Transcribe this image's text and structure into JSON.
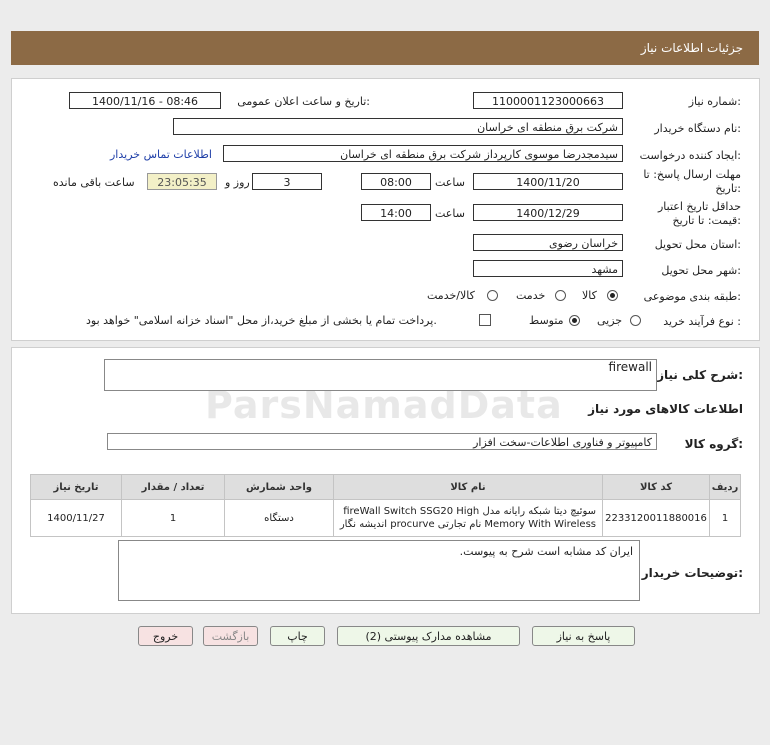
{
  "header": {
    "title": "جزئیات اطلاعات نیاز"
  },
  "form": {
    "need_number_label": "شماره نیاز:",
    "need_number": "1100001123000663",
    "announce_label": "تاریخ و ساعت اعلان عمومی:",
    "announce_value": "1400/11/16 - 08:46",
    "buyer_label": "نام دستگاه خریدار:",
    "buyer_value": "شرکت برق منطقه ای خراسان",
    "creator_label": "ایجاد کننده درخواست:",
    "creator_value": "سیدمجدرضا موسوی کارپرداز شرکت برق منطقه ای خراسان",
    "contact_link": "اطلاعات تماس خریدار",
    "deadline_label_1": "مهلت ارسال پاسخ: تا",
    "deadline_label_2": "تاریخ:",
    "deadline_date": "1400/11/20",
    "time_label": "ساعت",
    "deadline_time": "08:00",
    "days_value": "3",
    "days_label": "روز و",
    "remaining_value": "23:05:35",
    "remaining_label": "ساعت باقی مانده",
    "validity_label_1": "حداقل تاریخ اعتبار",
    "validity_label_2": "قیمت: تا تاریخ:",
    "validity_date": "1400/12/29",
    "validity_time_label": "ساعت",
    "validity_time": "14:00",
    "province_label": "استان محل تحویل:",
    "province_value": "خراسان رضوی",
    "city_label": "شهر محل تحویل:",
    "city_value": "مشهد",
    "category_label": "طبقه بندی موضوعی:",
    "category_options": [
      "کالا",
      "خدمت",
      "کالا/خدمت"
    ],
    "process_label": "نوع فرآیند خرید :",
    "process_options": [
      "جزیی",
      "متوسط"
    ],
    "payment_note": "پرداخت تمام یا بخشی از مبلغ خرید،از محل \"اسناد خزانه اسلامی\" خواهد بود."
  },
  "details": {
    "summary_label": "شرح کلی نیاز:",
    "summary_value": "firewall",
    "goods_info_title": "اطلاعات کالاهای مورد نیاز",
    "group_label": "گروه کالا:",
    "group_value": "کامپیوتر و فناوری اطلاعات-سخت افزار",
    "table": {
      "headers": [
        "ردیف",
        "کد کالا",
        "نام کالا",
        "واحد شمارش",
        "تعداد / مقدار",
        "تاریخ نیاز"
      ],
      "rows": [
        {
          "index": "1",
          "code": "2233120011880016",
          "name_line1": "سوئیچ دیتا شبکه رایانه مدل fireWall Switch SSG20 High",
          "name_line2": "Memory With Wireless نام تجارتی procurve اندیشه نگار",
          "unit": "دستگاه",
          "qty": "1",
          "date": "1400/11/27"
        }
      ]
    },
    "buyer_notes_label": "توضیحات خریدار:",
    "buyer_notes_value": "ایران کد مشابه است شرح به پیوست."
  },
  "buttons": {
    "reply": "پاسخ به نیاز",
    "docs": "مشاهده مدارک پیوستی (2)",
    "print": "چاپ",
    "back": "بازگشت",
    "exit": "خروج"
  },
  "watermark": {
    "text": "ParsNamadData"
  },
  "colors": {
    "header": "#8c6a45",
    "link": "#1f3fa8",
    "remaining_bg": "#f3f0c7",
    "button_green": "#eef7e8",
    "button_pink": "#f7e2e2"
  }
}
